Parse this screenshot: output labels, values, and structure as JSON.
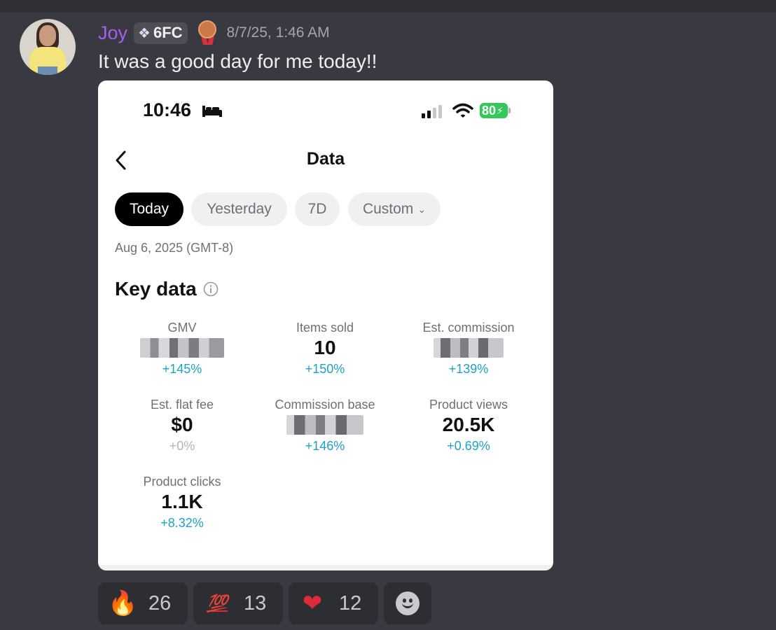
{
  "message": {
    "username": "Joy",
    "tag": "6FC",
    "tag_icon": "sparkle-diamond-icon",
    "badge_icon": "bronze-medal-icon",
    "timestamp": "8/7/25, 1:46 AM",
    "text": "It was a good day for me today!!"
  },
  "screenshot": {
    "status_bar": {
      "time": "10:46",
      "battery": "80",
      "icons": [
        "bed-icon",
        "signal-icon",
        "wifi-icon",
        "battery-icon"
      ]
    },
    "header": {
      "title": "Data"
    },
    "tabs": [
      {
        "label": "Today",
        "active": true
      },
      {
        "label": "Yesterday",
        "active": false
      },
      {
        "label": "7D",
        "active": false
      },
      {
        "label": "Custom",
        "active": false
      }
    ],
    "date": "Aug 6, 2025 (GMT-8)",
    "key_data": {
      "title": "Key data",
      "metrics": [
        {
          "label": "GMV",
          "value": "",
          "change": "+145%",
          "hidden": true
        },
        {
          "label": "Items sold",
          "value": "10",
          "change": "+150%"
        },
        {
          "label": "Est. commission",
          "value": "",
          "change": "+139%",
          "hidden": true
        },
        {
          "label": "Est. flat fee",
          "value": "$0",
          "change": "+0%"
        },
        {
          "label": "Commission base",
          "value": "",
          "change": "+146%",
          "hidden": true
        },
        {
          "label": "Product views",
          "value": "20.5K",
          "change": "+0.69%"
        },
        {
          "label": "Product clicks",
          "value": "1.1K",
          "change": "+8.32%"
        }
      ]
    }
  },
  "reactions": [
    {
      "emoji": "🔥",
      "name": "fire",
      "count": "26"
    },
    {
      "emoji": "💯",
      "name": "hundred-points",
      "count": "13"
    },
    {
      "emoji": "❤",
      "name": "heart",
      "count": "12"
    }
  ],
  "colors": {
    "background": "#393a41",
    "username": "#a95df0",
    "accent_change": "#1ba3c7",
    "battery": "#34c759"
  }
}
